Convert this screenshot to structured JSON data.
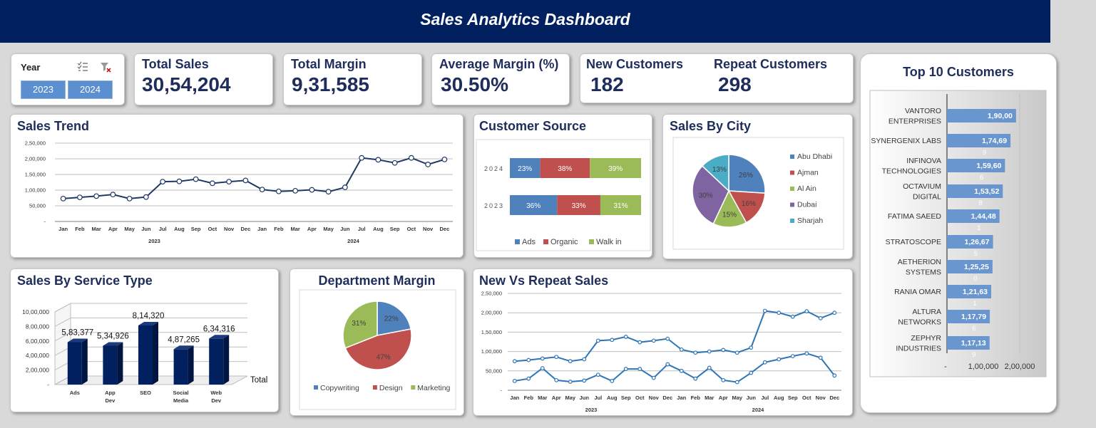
{
  "header": {
    "title": "Sales Analytics Dashboard"
  },
  "slicer": {
    "label": "Year",
    "buttons": [
      "2023",
      "2024"
    ]
  },
  "kpis": {
    "total_sales": {
      "label": "Total Sales",
      "value": "30,54,204"
    },
    "total_margin": {
      "label": "Total Margin",
      "value": "9,31,585"
    },
    "avg_margin": {
      "label": "Average Margin (%)",
      "value": "30.50%"
    },
    "new_customers": {
      "label": "New Customers",
      "value": "182"
    },
    "repeat_customers": {
      "label": "Repeat Customers",
      "value": "298"
    }
  },
  "titles": {
    "sales_trend": "Sales Trend",
    "customer_source": "Customer Source",
    "sales_by_city": "Sales By City",
    "top10": "Top 10 Customers",
    "service_type": "Sales By Service Type",
    "dept_margin": "Department Margin",
    "new_vs_repeat": "New Vs Repeat Sales"
  },
  "colors": {
    "navy": "#002060",
    "line": "#1f3864",
    "line2": "#2e75b6",
    "blue": "#4f81bd",
    "red": "#c0504d",
    "green": "#9bbb59",
    "purple": "#8064a2",
    "cyan": "#4bacc6",
    "bar_top10": "#6a96cf"
  },
  "chart_data": [
    {
      "id": "sales_trend",
      "type": "line",
      "months": [
        "Jan",
        "Feb",
        "Mar",
        "Apr",
        "May",
        "Jun",
        "Jul",
        "Aug",
        "Sep",
        "Oct",
        "Nov",
        "Dec",
        "Jan",
        "Feb",
        "Mar",
        "Apr",
        "May",
        "Jun",
        "Jul",
        "Aug",
        "Sep",
        "Oct",
        "Nov",
        "Dec"
      ],
      "years": [
        "2023",
        "2024"
      ],
      "values": [
        73000,
        77000,
        81000,
        86000,
        73000,
        78000,
        127000,
        128000,
        135000,
        122000,
        127000,
        131000,
        102000,
        96000,
        98000,
        101000,
        95000,
        109000,
        203000,
        197000,
        187000,
        203000,
        182000,
        198000
      ],
      "yticks": [
        "-",
        "50,000",
        "1,00,000",
        "1,50,000",
        "2,00,000",
        "2,50,000"
      ],
      "ylim": [
        0,
        250000
      ]
    },
    {
      "id": "customer_source",
      "type": "bar",
      "stacked": true,
      "categories": [
        "2024",
        "2023"
      ],
      "series": [
        {
          "name": "Ads",
          "values": [
            23,
            36
          ]
        },
        {
          "name": "Organic",
          "values": [
            38,
            33
          ]
        },
        {
          "name": "Walk in",
          "values": [
            39,
            31
          ]
        }
      ]
    },
    {
      "id": "sales_by_city",
      "type": "pie",
      "labels": [
        "Abu Dhabi",
        "Ajman",
        "Al Ain",
        "Dubai",
        "Sharjah"
      ],
      "values": [
        26,
        16,
        15,
        30,
        13
      ],
      "data_labels": [
        "26%",
        "16%",
        "15%",
        "30%",
        "13%"
      ]
    },
    {
      "id": "top10_customers",
      "type": "bar",
      "orientation": "horizontal",
      "categories": [
        [
          "VANTORO",
          "ENTERPRISES"
        ],
        [
          "SYNERGENIX LABS"
        ],
        [
          "INFINOVA",
          "TECHNOLOGIES"
        ],
        [
          "OCTAVIUM",
          "DIGITAL"
        ],
        [
          "FATIMA SAEED"
        ],
        [
          "STRATOSCOPE"
        ],
        [
          "AETHERION",
          "SYSTEMS"
        ],
        [
          "RANIA OMAR"
        ],
        [
          "ALTURA",
          "NETWORKS"
        ],
        [
          "ZEPHYR",
          "INDUSTRIES"
        ]
      ],
      "values": [
        190000,
        174690,
        159606,
        153528,
        144481,
        126675,
        125250,
        121631,
        117796,
        117139
      ],
      "labels_main": [
        "1,90,00",
        "1,74,69",
        "1,59,60",
        "1,53,52",
        "1,44,48",
        "1,26,67",
        "1,25,25",
        "1,21,63",
        "1,17,79",
        "1,17,13"
      ],
      "labels_overflow": [
        "",
        "9",
        "6",
        "8",
        "1",
        "5",
        "0",
        "1",
        "6",
        "9"
      ],
      "xticks": [
        "-",
        "1,00,000",
        "2,00,000"
      ],
      "xlim": [
        0,
        200000
      ]
    },
    {
      "id": "sales_by_service",
      "type": "bar",
      "style": "3d",
      "categories": [
        "Ads",
        "App Dev",
        "SEO",
        "Social Media",
        "Web Dev"
      ],
      "values": [
        583377,
        534926,
        814320,
        487265,
        634316
      ],
      "data_labels": [
        "5,83,377",
        "5,34,926",
        "8,14,320",
        "4,87,265",
        "6,34,316"
      ],
      "yticks": [
        "-",
        "2,00,000",
        "4,00,000",
        "6,00,000",
        "8,00,000",
        "10,00,000"
      ],
      "ylim": [
        0,
        1000000
      ],
      "series_name": "Total"
    },
    {
      "id": "department_margin",
      "type": "pie",
      "labels": [
        "Copywriting",
        "Design",
        "Marketing"
      ],
      "values": [
        22,
        47,
        31
      ],
      "data_labels": [
        "22%",
        "47%",
        "31%"
      ]
    },
    {
      "id": "new_vs_repeat",
      "type": "line",
      "months": [
        "Jan",
        "Feb",
        "Mar",
        "Apr",
        "May",
        "Jun",
        "Jul",
        "Aug",
        "Sep",
        "Oct",
        "Nov",
        "Dec",
        "Jan",
        "Feb",
        "Mar",
        "Apr",
        "May",
        "Jun",
        "Jul",
        "Aug",
        "Sep",
        "Oct",
        "Nov",
        "Dec"
      ],
      "years": [
        "2023",
        "2024"
      ],
      "series": [
        {
          "values": [
            75000,
            78000,
            82000,
            86000,
            75000,
            80000,
            128000,
            130000,
            138000,
            124000,
            128000,
            133000,
            105000,
            97000,
            100000,
            104000,
            97000,
            110000,
            205000,
            200000,
            190000,
            204000,
            186000,
            200000
          ]
        },
        {
          "values": [
            24000,
            30000,
            57000,
            26000,
            22000,
            25000,
            40000,
            24000,
            55000,
            55000,
            32000,
            67000,
            50000,
            30000,
            58000,
            26000,
            21000,
            45000,
            72000,
            80000,
            88000,
            95000,
            84000,
            38000
          ]
        }
      ],
      "yticks": [
        "-",
        "50,000",
        "1,00,000",
        "1,50,000",
        "2,00,000",
        "2,50,000"
      ],
      "ylim": [
        0,
        250000
      ]
    }
  ]
}
